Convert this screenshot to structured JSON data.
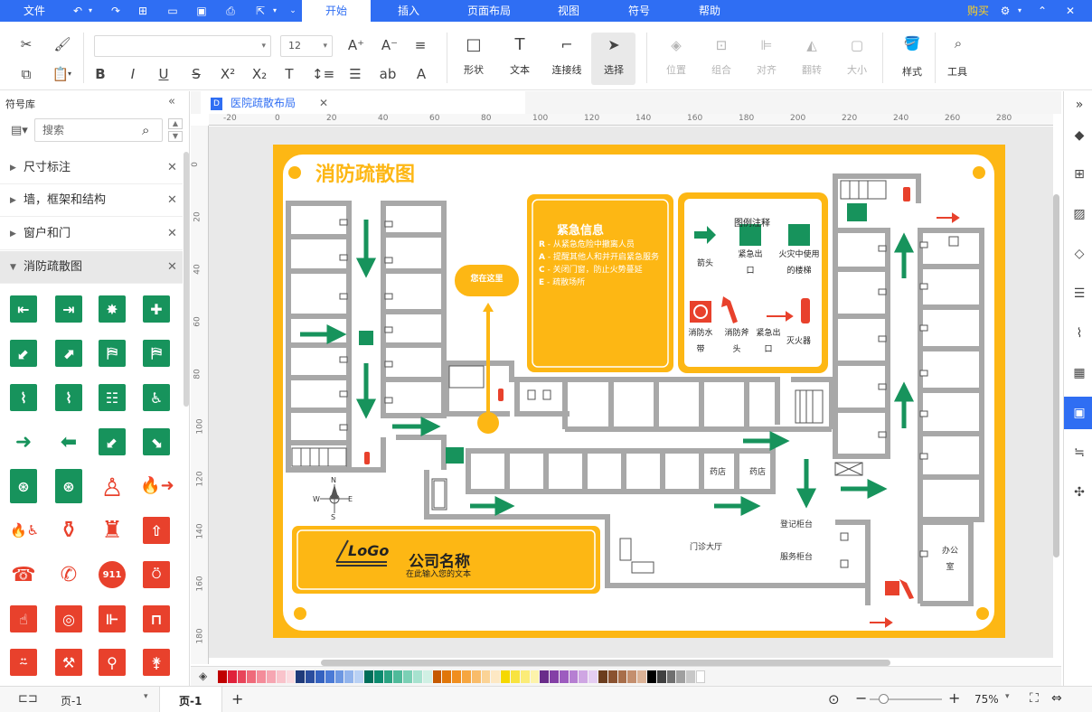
{
  "menubar": {
    "file": "文件",
    "tabs": [
      "开始",
      "插入",
      "页面布局",
      "视图",
      "符号",
      "帮助"
    ],
    "active_tab": "开始",
    "buy": "购买"
  },
  "toolbar": {
    "font_name": "",
    "font_size": "12",
    "big_buttons": [
      "形状",
      "文本",
      "连接线",
      "选择"
    ],
    "disabled_buttons": [
      "位置",
      "组合",
      "对齐",
      "翻转",
      "大小"
    ],
    "style_label": "样式",
    "tools_label": "工具"
  },
  "left_panel": {
    "title": "符号库",
    "search_placeholder": "搜索",
    "categories": [
      "尺寸标注",
      "墙，框架和结构",
      "窗户和门",
      "消防疏散图"
    ]
  },
  "document": {
    "tab_title": "医院疏散布局",
    "ruler_h": [
      "-20",
      "0",
      "20",
      "40",
      "60",
      "80",
      "100",
      "120",
      "140",
      "160",
      "180",
      "200",
      "220",
      "240",
      "260",
      "280"
    ],
    "ruler_v": [
      "0",
      "20",
      "40",
      "60",
      "80",
      "100",
      "120",
      "140",
      "160",
      "180"
    ]
  },
  "diagram": {
    "title": "消防疏散图",
    "you_are_here": "您在这里",
    "emergency_title": "紧急信息",
    "emergency_items": [
      {
        "k": "R",
        "t": " - 从紧急危险中撤离人员"
      },
      {
        "k": "A",
        "t": " - 提醒其他人和并开启紧急服务"
      },
      {
        "k": "C",
        "t": " - 关闭门窗，防止火势蔓延"
      },
      {
        "k": "E",
        "t": " - 疏散场所"
      }
    ],
    "legend_title": "图例注释",
    "legend": {
      "arrow": "箭头",
      "exit": "紧急出口",
      "fire_stairs": "火灾中使用的楼梯",
      "hose": "消防水带",
      "axe": "消防斧头",
      "exit2": "紧急出口",
      "extinguisher": "灭火器"
    },
    "rooms": {
      "pharmacy1": "药店",
      "pharmacy2": "药店",
      "lobby": "门诊大厅",
      "registration": "登记柜台",
      "service": "服务柜台",
      "office": "办公室"
    },
    "compass": {
      "n": "N",
      "s": "S",
      "e": "E",
      "w": "W"
    },
    "company": "公司名称",
    "company_sub": "在此输入您的文本",
    "logo": "LoGo"
  },
  "status": {
    "page_select": "页-1",
    "page_tab": "页-1",
    "add": "+",
    "zoom": "75%"
  },
  "colors": {
    "accent": "#2f6ef3",
    "page_frame": "#fdb714",
    "safe_green": "#17935c",
    "fire_red": "#e8412c",
    "wall_gray": "#a8a8a8"
  }
}
